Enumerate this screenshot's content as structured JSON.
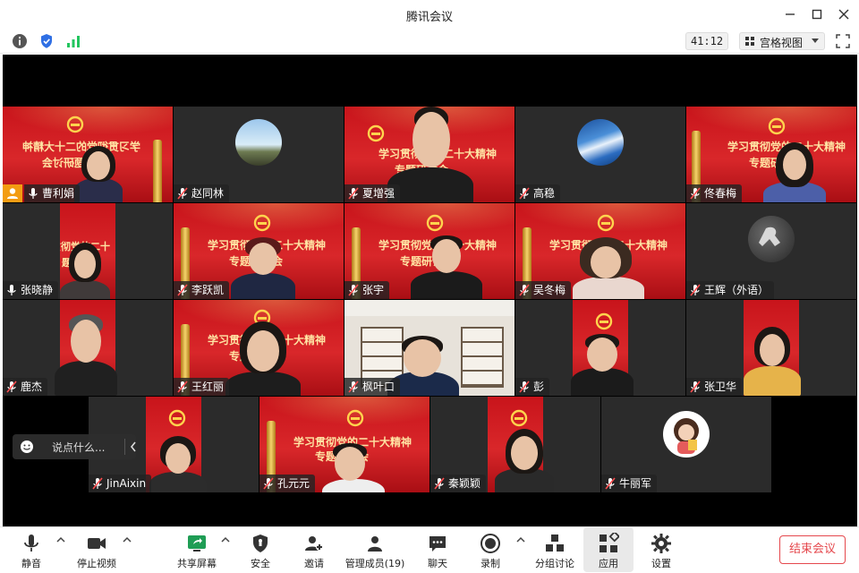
{
  "window": {
    "title": "腾讯会议"
  },
  "infobar": {
    "timer": "41:12",
    "view_mode": "宫格视图"
  },
  "banner_texts": {
    "full": "学习贯彻党的二十大精神",
    "sub_zhuanti": "专题研讨会",
    "left_cut": "贯彻党的二十",
    "left_cut2": "题研讨会",
    "mirror": "学习贯彻党的二十大精神",
    "mirror2": "专题研讨会"
  },
  "participants": [
    {
      "name": "曹利娟",
      "mic": "on",
      "host": true,
      "active": true
    },
    {
      "name": "赵同林",
      "mic": "off"
    },
    {
      "name": "夏增强",
      "mic": "off"
    },
    {
      "name": "高稳",
      "mic": "off"
    },
    {
      "name": "佟春梅",
      "mic": "off"
    },
    {
      "name": "张晓静",
      "mic": "on"
    },
    {
      "name": "李跃凯",
      "mic": "off"
    },
    {
      "name": "张宇",
      "mic": "off"
    },
    {
      "name": "吴冬梅",
      "mic": "off"
    },
    {
      "name": "王辉（外语）",
      "mic": "off"
    },
    {
      "name": "鹿杰",
      "mic": "off"
    },
    {
      "name": "王红丽",
      "mic": "off"
    },
    {
      "name": "枫叶口",
      "mic": "off"
    },
    {
      "name": "彭",
      "mic": "off"
    },
    {
      "name": "张卫华",
      "mic": "off"
    },
    {
      "name": "JinAixin",
      "mic": "off"
    },
    {
      "name": "孔元元",
      "mic": "off"
    },
    {
      "name": "秦颖颖",
      "mic": "off"
    },
    {
      "name": "牛丽军",
      "mic": "off"
    }
  ],
  "chat_float": {
    "placeholder": "说点什么..."
  },
  "toolbar": {
    "mute": "静音",
    "stop_video": "停止视频",
    "share_screen": "共享屏幕",
    "security": "安全",
    "invite": "邀请",
    "manage_members": "管理成员(19)",
    "chat": "聊天",
    "record": "录制",
    "breakout": "分组讨论",
    "apps": "应用",
    "settings": "设置",
    "end_meeting": "结束会议"
  },
  "colors": {
    "accent_green": "#22c55e",
    "end_red": "#e5484d",
    "banner_red": "#c8141b",
    "host_orange": "#f39c12"
  }
}
